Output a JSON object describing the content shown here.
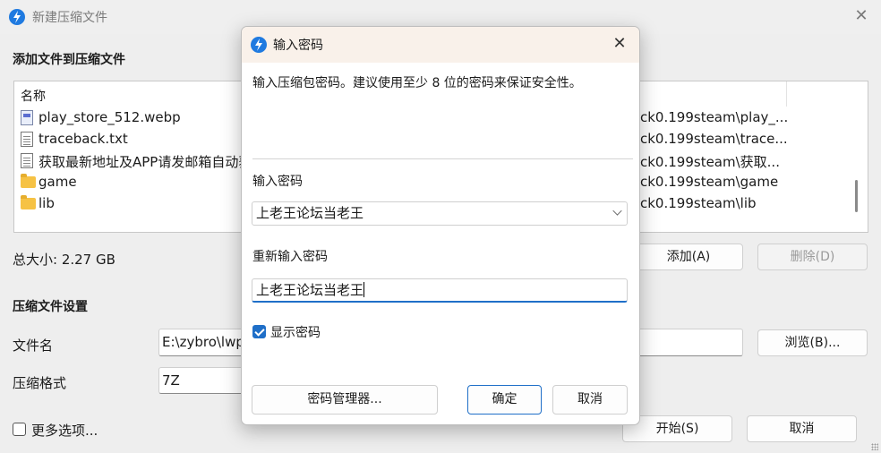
{
  "main_window": {
    "title": "新建压缩文件",
    "close_glyph": "✕",
    "add_files_heading": "添加文件到压缩文件",
    "file_list": {
      "column_name": "名称",
      "rows": [
        {
          "name": "play_store_512.webp",
          "path": "ck0.199steam\\play_...",
          "icon": "image-file-icon"
        },
        {
          "name": "traceback.txt",
          "path": "ck0.199steam\\trace...",
          "icon": "text-file-icon"
        },
        {
          "name": "获取最新地址及APP请发邮箱自动获",
          "path": "ck0.199steam\\获取...",
          "icon": "text-file-icon"
        },
        {
          "name": "game",
          "path": "ck0.199steam\\game",
          "icon": "folder-icon"
        },
        {
          "name": "lib",
          "path": "ck0.199steam\\lib",
          "icon": "folder-icon"
        }
      ]
    },
    "total_size": "总大小: 2.27 GB",
    "add_button": "添加(A)",
    "delete_button": "删除(D)",
    "settings_heading": "压缩文件设置",
    "filename_label": "文件名",
    "filename_value": "E:\\zybro\\lwp",
    "browse_button": "浏览(B)...",
    "format_label": "压缩格式",
    "format_value": "7Z",
    "more_options_label": "更多选项...",
    "more_options_checked": false,
    "start_button": "开始(S)",
    "cancel_button": "取消"
  },
  "dialog": {
    "title": "输入密码",
    "close_glyph": "✕",
    "description": "输入压缩包密码。建议使用至少 8 位的密码来保证安全性。",
    "password_label": "输入密码",
    "password_value": "上老王论坛当老王",
    "confirm_label": "重新输入密码",
    "confirm_value": "上老王论坛当老王",
    "show_password_label": "显示密码",
    "show_password_checked": true,
    "password_manager_button": "密码管理器...",
    "ok_button": "确定",
    "cancel_button": "取消"
  },
  "colors": {
    "accent": "#1f6fc8",
    "dialog_titlebar": "#f9f1ea",
    "window_bg": "#eeeeee"
  }
}
